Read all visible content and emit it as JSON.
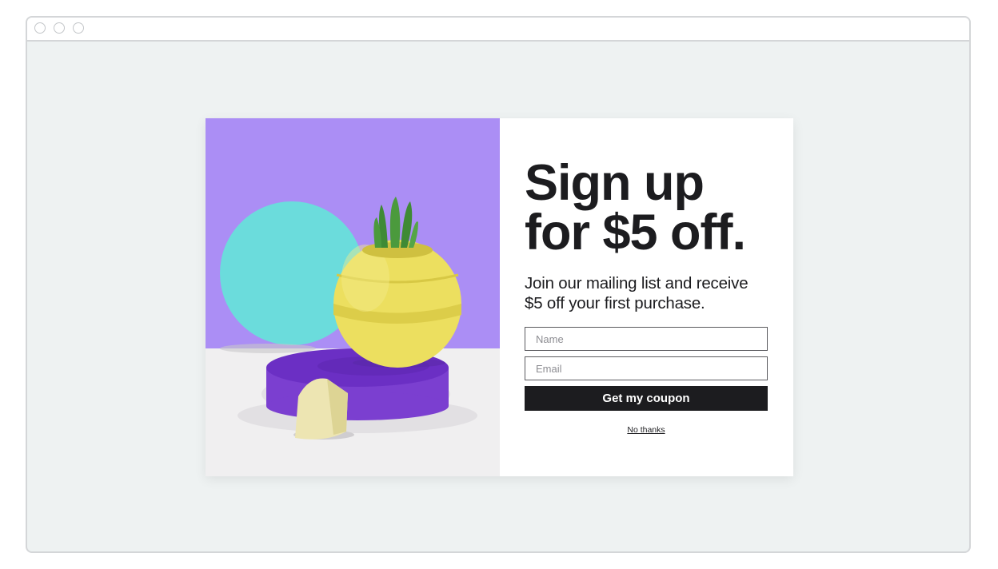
{
  "window": {
    "controls": [
      "close-dot",
      "minimize-dot",
      "maximize-dot"
    ]
  },
  "popup": {
    "headline_line1": "Sign up",
    "headline_line2": "for $5 off.",
    "subheading": "Join our mailing list and receive $5 off your first purchase.",
    "name_placeholder": "Name",
    "email_placeholder": "Email",
    "name_value": "",
    "email_value": "",
    "cta_label": "Get my coupon",
    "dismiss_label": "No thanks"
  },
  "colors": {
    "page_background": "#eef2f2",
    "art_background_top": "#ab8ef5",
    "art_floor": "#f0eff0",
    "teal_disc": "#6bdcdc",
    "pedestal": "#7b3fd0",
    "planter": "#ecdf5f",
    "cactus": "#3f8a35",
    "block": "#ede5b2",
    "button": "#1c1c1f",
    "text": "#1c1c1f"
  }
}
